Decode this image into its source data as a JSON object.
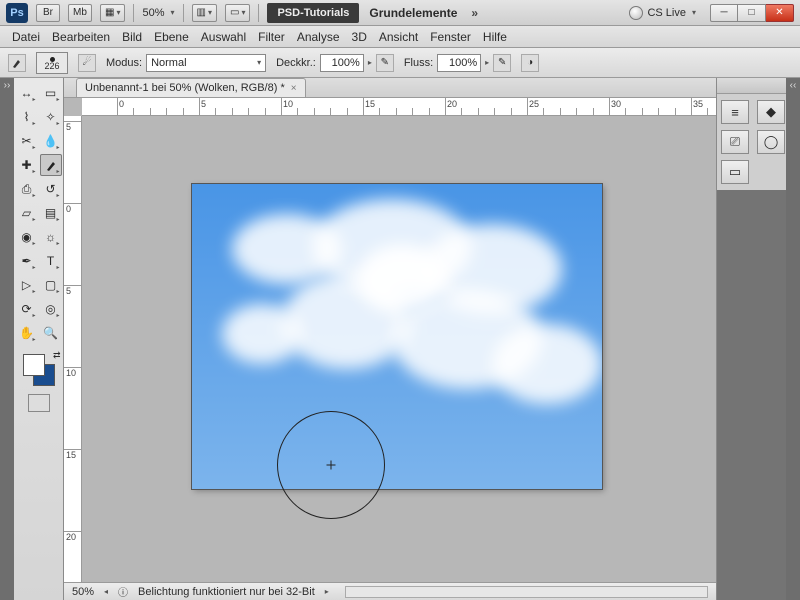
{
  "titlebar": {
    "app_abbr": "Ps",
    "quick_buttons": [
      "Br",
      "Mb"
    ],
    "zoom": "50%",
    "dark_tab": "PSD-Tutorials",
    "doc_title": "Grundelemente",
    "cs_live": "CS Live",
    "view_dropdown_caret": "▾"
  },
  "menubar": [
    "Datei",
    "Bearbeiten",
    "Bild",
    "Ebene",
    "Auswahl",
    "Filter",
    "Analyse",
    "3D",
    "Ansicht",
    "Fenster",
    "Hilfe"
  ],
  "optionsbar": {
    "brush_size": "226",
    "modus_label": "Modus:",
    "modus_value": "Normal",
    "opacity_label": "Deckkr.:",
    "opacity_value": "100%",
    "flow_label": "Fluss:",
    "flow_value": "100%"
  },
  "doc_tab": "Unbenannt-1 bei 50% (Wolken, RGB/8) *",
  "ruler_h_labels": [
    "0",
    "5",
    "10",
    "15",
    "20",
    "25",
    "30",
    "35"
  ],
  "ruler_v_labels": [
    "5",
    "0",
    "5",
    "10",
    "15",
    "20"
  ],
  "statusbar": {
    "zoom": "50%",
    "message": "Belichtung funktioniert nur bei 32-Bit"
  },
  "colors": {
    "fg_swatch": "#ffffff",
    "bg_swatch": "#1a4d8f",
    "canvas_sky_top": "#4995e6",
    "canvas_sky_bottom": "#7cb4ec"
  },
  "tools": [
    "move",
    "rect-marquee",
    "lasso",
    "magic-wand",
    "crop",
    "eyedropper",
    "spot-heal",
    "brush",
    "clone",
    "history-brush",
    "eraser",
    "gradient",
    "blur",
    "dodge",
    "pen",
    "type",
    "path-select",
    "rectangle",
    "hand",
    "zoom",
    "3d-rotate",
    "3d-orbit"
  ],
  "right_panel_icons": [
    "adjustments",
    "layers",
    "styles",
    "channels",
    "paths",
    "mask"
  ]
}
